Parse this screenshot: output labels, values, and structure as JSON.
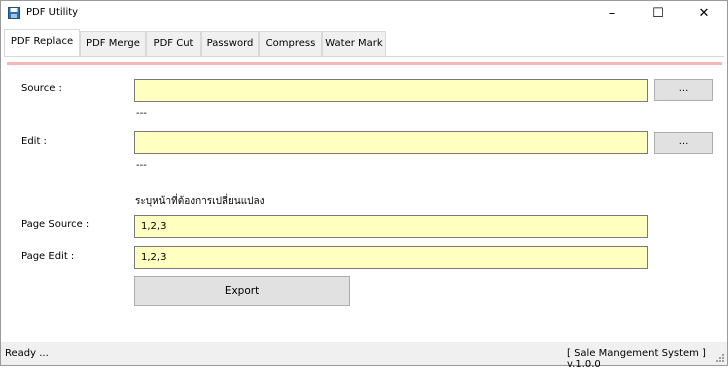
{
  "window": {
    "title": "PDF Utility",
    "minimize_label": "–",
    "maximize_label": "☐",
    "close_label": "✕"
  },
  "tabs": [
    {
      "label": "PDF Replace",
      "active": true
    },
    {
      "label": "PDF Merge",
      "active": false
    },
    {
      "label": "PDF Cut",
      "active": false
    },
    {
      "label": "Password",
      "active": false
    },
    {
      "label": "Compress",
      "active": false
    },
    {
      "label": "Water Mark",
      "active": false
    }
  ],
  "form": {
    "source_label": "Source :",
    "source_value": "",
    "source_browse": "...",
    "source_info": "---",
    "edit_label": "Edit :",
    "edit_value": "",
    "edit_browse": "...",
    "edit_info": "---",
    "instruction": "ระบุหน้าที่ต้องการเปลี่ยนแปลง",
    "page_source_label": "Page Source :",
    "page_source_value": "1,2,3",
    "page_edit_label": "Page Edit :",
    "page_edit_value": "1,2,3",
    "export_label": "Export"
  },
  "status": {
    "left": "Ready ...",
    "right": "[ Sale Mangement System ]  v.1.0.0"
  },
  "colors": {
    "field_bg": "#ffffc0",
    "accent_line": "#f4b6b6"
  }
}
